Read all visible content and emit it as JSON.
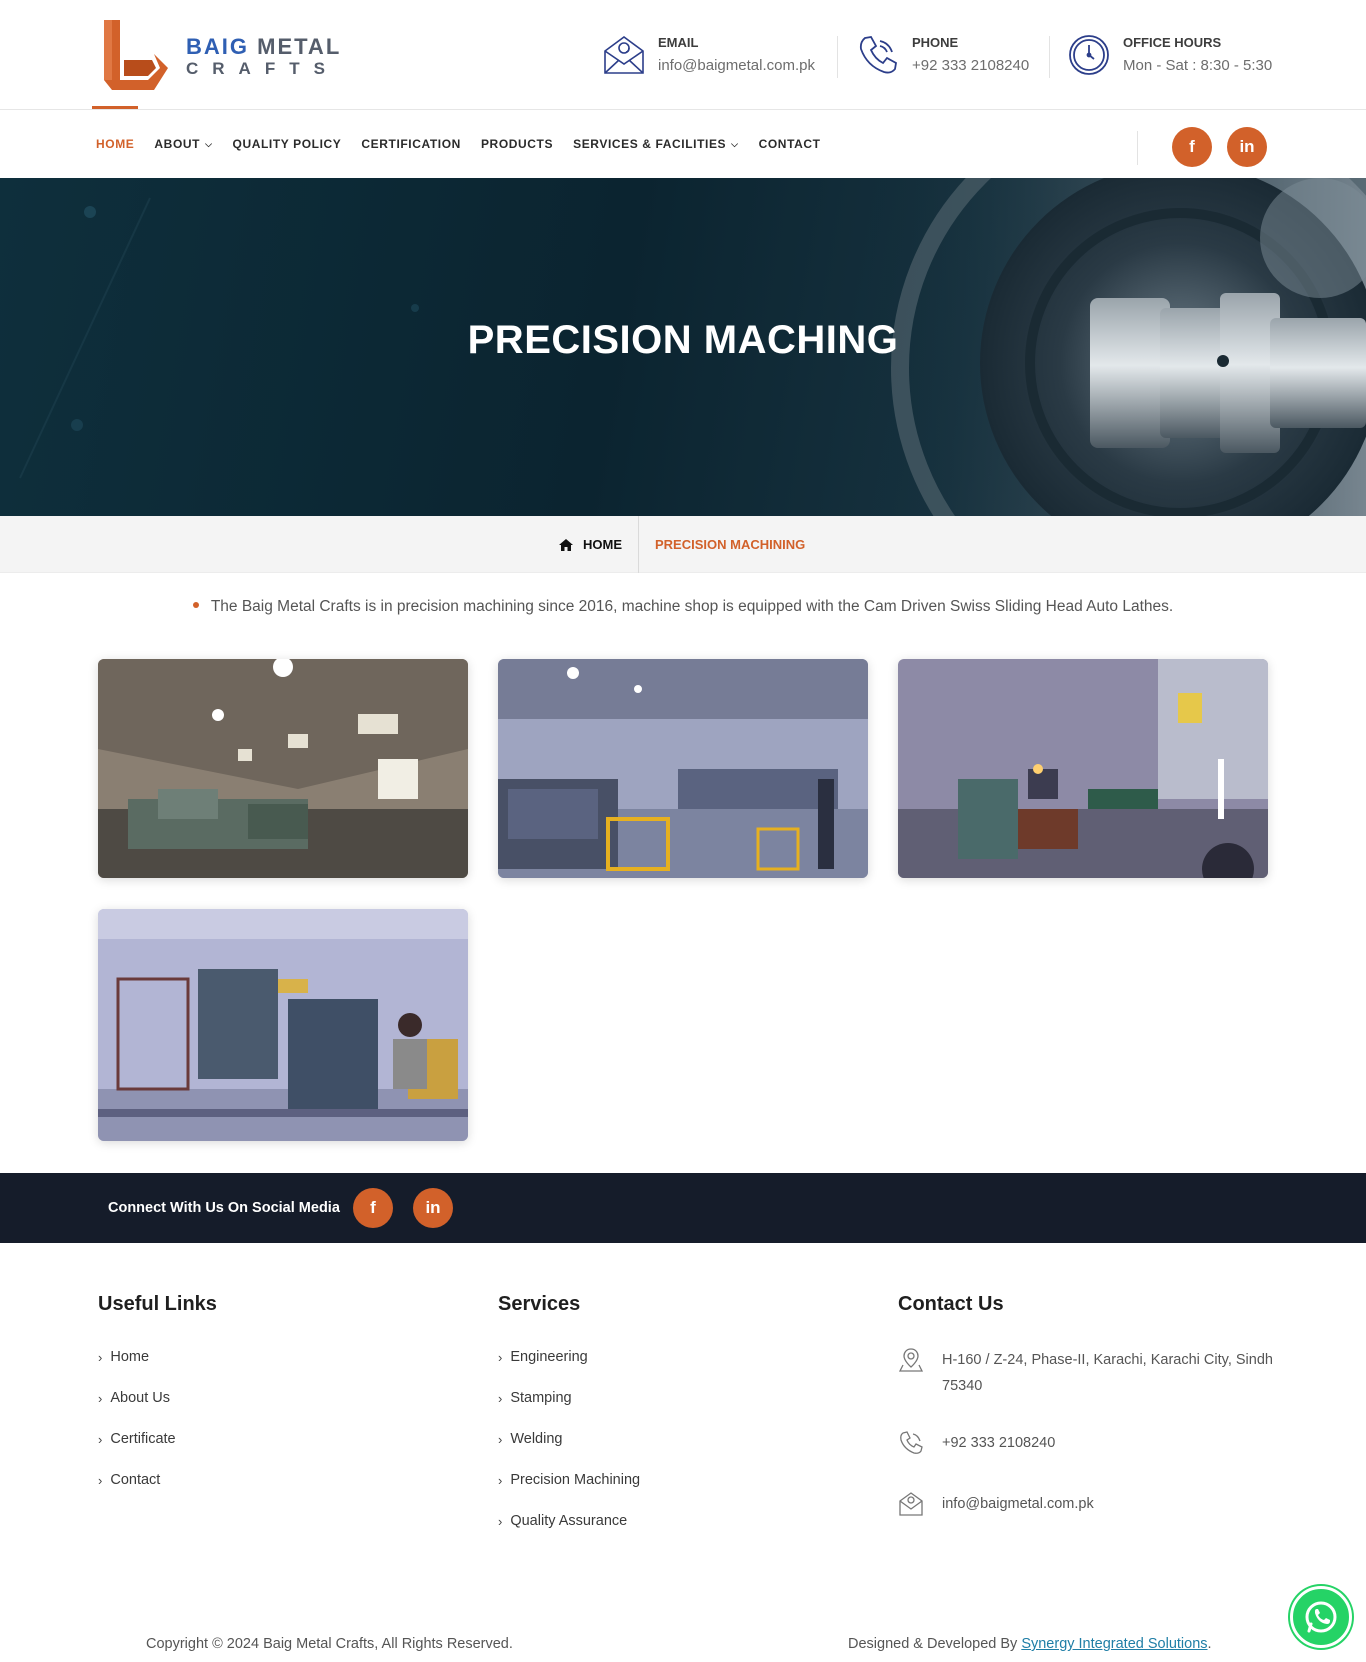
{
  "brand": {
    "name_part1": "BAIG",
    "name_part2": "METAL",
    "name_line2": "CRAFTS",
    "colors": {
      "accent": "#d2612a",
      "brand_blue": "#2f5fb3",
      "dark": "#151c2a"
    }
  },
  "header": {
    "email": {
      "label": "EMAIL",
      "value": "info@baigmetal.com.pk",
      "icon": "email-icon"
    },
    "phone": {
      "label": "PHONE",
      "value": "+92 333 2108240",
      "icon": "phone-icon"
    },
    "hours": {
      "label": "OFFICE HOURS",
      "value": "Mon - Sat : 8:30 - 5:30",
      "icon": "clock-icon"
    }
  },
  "nav": {
    "items": [
      {
        "label": "HOME",
        "active": true,
        "dropdown": false
      },
      {
        "label": "ABOUT",
        "active": false,
        "dropdown": true
      },
      {
        "label": "QUALITY POLICY",
        "active": false,
        "dropdown": false
      },
      {
        "label": "CERTIFICATION",
        "active": false,
        "dropdown": false
      },
      {
        "label": "PRODUCTS",
        "active": false,
        "dropdown": false
      },
      {
        "label": "SERVICES & FACILITIES",
        "active": false,
        "dropdown": true
      },
      {
        "label": "CONTACT",
        "active": false,
        "dropdown": false
      }
    ],
    "social": {
      "facebook": "f",
      "linkedin": "in"
    }
  },
  "hero": {
    "title": "PRECISION MACHING"
  },
  "breadcrumb": {
    "home": "HOME",
    "current": "PRECISION MACHINING"
  },
  "intro": "The Baig Metal Crafts is in precision machining since 2016, machine shop is equipped with the Cam Driven Swiss Sliding Head Auto Lathes.",
  "social_strip": {
    "label": "Connect With Us On Social Media",
    "facebook": "f",
    "linkedin": "in"
  },
  "footer": {
    "useful_links": {
      "title": "Useful Links",
      "items": [
        "Home",
        "About Us",
        "Certificate",
        "Contact"
      ]
    },
    "services": {
      "title": "Services",
      "items": [
        "Engineering",
        "Stamping",
        "Welding",
        "Precision Machining",
        "Quality Assurance"
      ]
    },
    "contact": {
      "title": "Contact Us",
      "address": "H-160 / Z-24, Phase-II, Karachi, Karachi City, Sindh 75340",
      "phone": "+92 333 2108240",
      "email": "info@baigmetal.com.pk"
    },
    "copyright": "Copyright © 2024 Baig Metal Crafts, All Rights Reserved.",
    "designed_prefix": "Designed & Developed By ",
    "designed_link": "Synergy Integrated Solutions",
    "designed_suffix": "."
  }
}
